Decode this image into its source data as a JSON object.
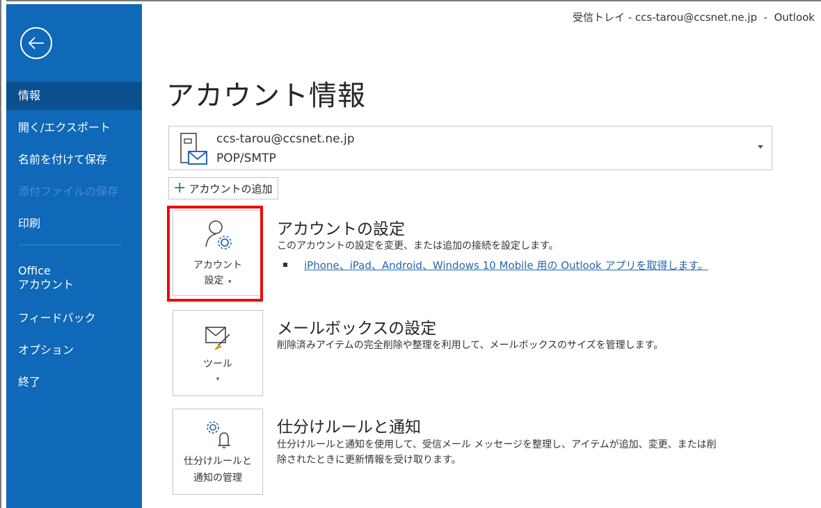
{
  "window": {
    "title": "受信トレイ - ccs-tarou@ccsnet.ne.jp  -  Outlook"
  },
  "sidebar": {
    "back_icon": "back-arrow-icon",
    "items": [
      {
        "label": "情報",
        "active": true
      },
      {
        "label": "開く/エクスポート"
      },
      {
        "label": "名前を付けて保存"
      },
      {
        "label": "添付ファイルの保存",
        "disabled": true
      },
      {
        "label": "印刷"
      },
      {
        "label_line1": "Office",
        "label_line2": "アカウント"
      },
      {
        "label": "フィードバック"
      },
      {
        "label": "オプション"
      },
      {
        "label": "終了"
      }
    ]
  },
  "main": {
    "title": "アカウント情報",
    "account": {
      "email": "ccs-tarou@ccsnet.ne.jp",
      "type": "POP/SMTP",
      "icon": "account-mailbox-icon"
    },
    "add_account_label": "アカウントの追加",
    "sections": [
      {
        "button_line1": "アカウント",
        "button_line2": "設定",
        "icon": "account-settings-icon",
        "title": "アカウントの設定",
        "description": "このアカウントの設定を変更、または追加の接続を設定します。",
        "link": "iPhone、iPad、Android、Windows 10 Mobile 用の Outlook アプリを取得します。"
      },
      {
        "button_line1": "ツール",
        "icon": "mailbox-cleanup-icon",
        "title": "メールボックスの設定",
        "description": "削除済みアイテムの完全削除や整理を利用して、メールボックスのサイズを管理します。"
      },
      {
        "button_line1": "仕分けルールと",
        "button_line2": "通知の管理",
        "icon": "rules-alerts-icon",
        "title": "仕分けルールと通知",
        "description_line1": "仕分けルールと通知を使用して、受信メール メッセージを整理し、アイテムが追加、変更、または削",
        "description_line2": "除されたときに更新情報を受け取ります。"
      }
    ]
  },
  "colors": {
    "sidebar": "#0f68b8",
    "sidebar_active": "#0b4f8f",
    "highlight": "#ec0b0b",
    "link": "#2566b0"
  }
}
